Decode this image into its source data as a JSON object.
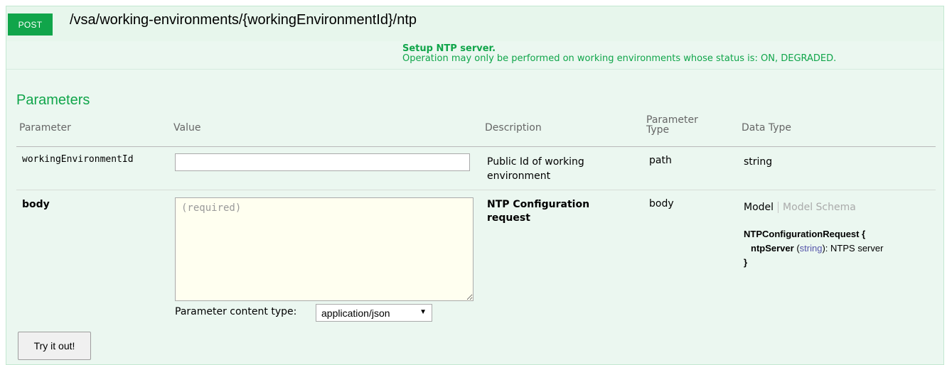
{
  "operation": {
    "method": "POST",
    "path": "/vsa/working-environments/{workingEnvironmentId}/ntp",
    "summary_title": "Setup NTP server.",
    "summary_desc": "Operation may only be performed on working environments whose status is: ON, DEGRADED."
  },
  "parameters": {
    "heading": "Parameters",
    "headers": {
      "parameter": "Parameter",
      "value": "Value",
      "description": "Description",
      "param_type": "Parameter Type",
      "data_type": "Data Type"
    },
    "rows": [
      {
        "name": "workingEnvironmentId",
        "value": "",
        "description": "Public Id of working environment",
        "param_type": "path",
        "data_type": "string"
      },
      {
        "name": "body",
        "placeholder": "(required)",
        "description": "NTP Configuration request",
        "param_type": "body",
        "content_type_label": "Parameter content type:",
        "content_type_value": "application/json"
      }
    ]
  },
  "model": {
    "tab_model": "Model",
    "tab_schema": "Model Schema",
    "name": "NTPConfigurationRequest",
    "open_brace": "{",
    "close_brace": "}",
    "prop_name": "ntpServer",
    "prop_type": "string",
    "prop_desc": "NTPS server"
  },
  "actions": {
    "try_it_out": "Try it out!"
  },
  "colors": {
    "accent": "#10a54a",
    "panel_bg": "#ebf7f0"
  }
}
